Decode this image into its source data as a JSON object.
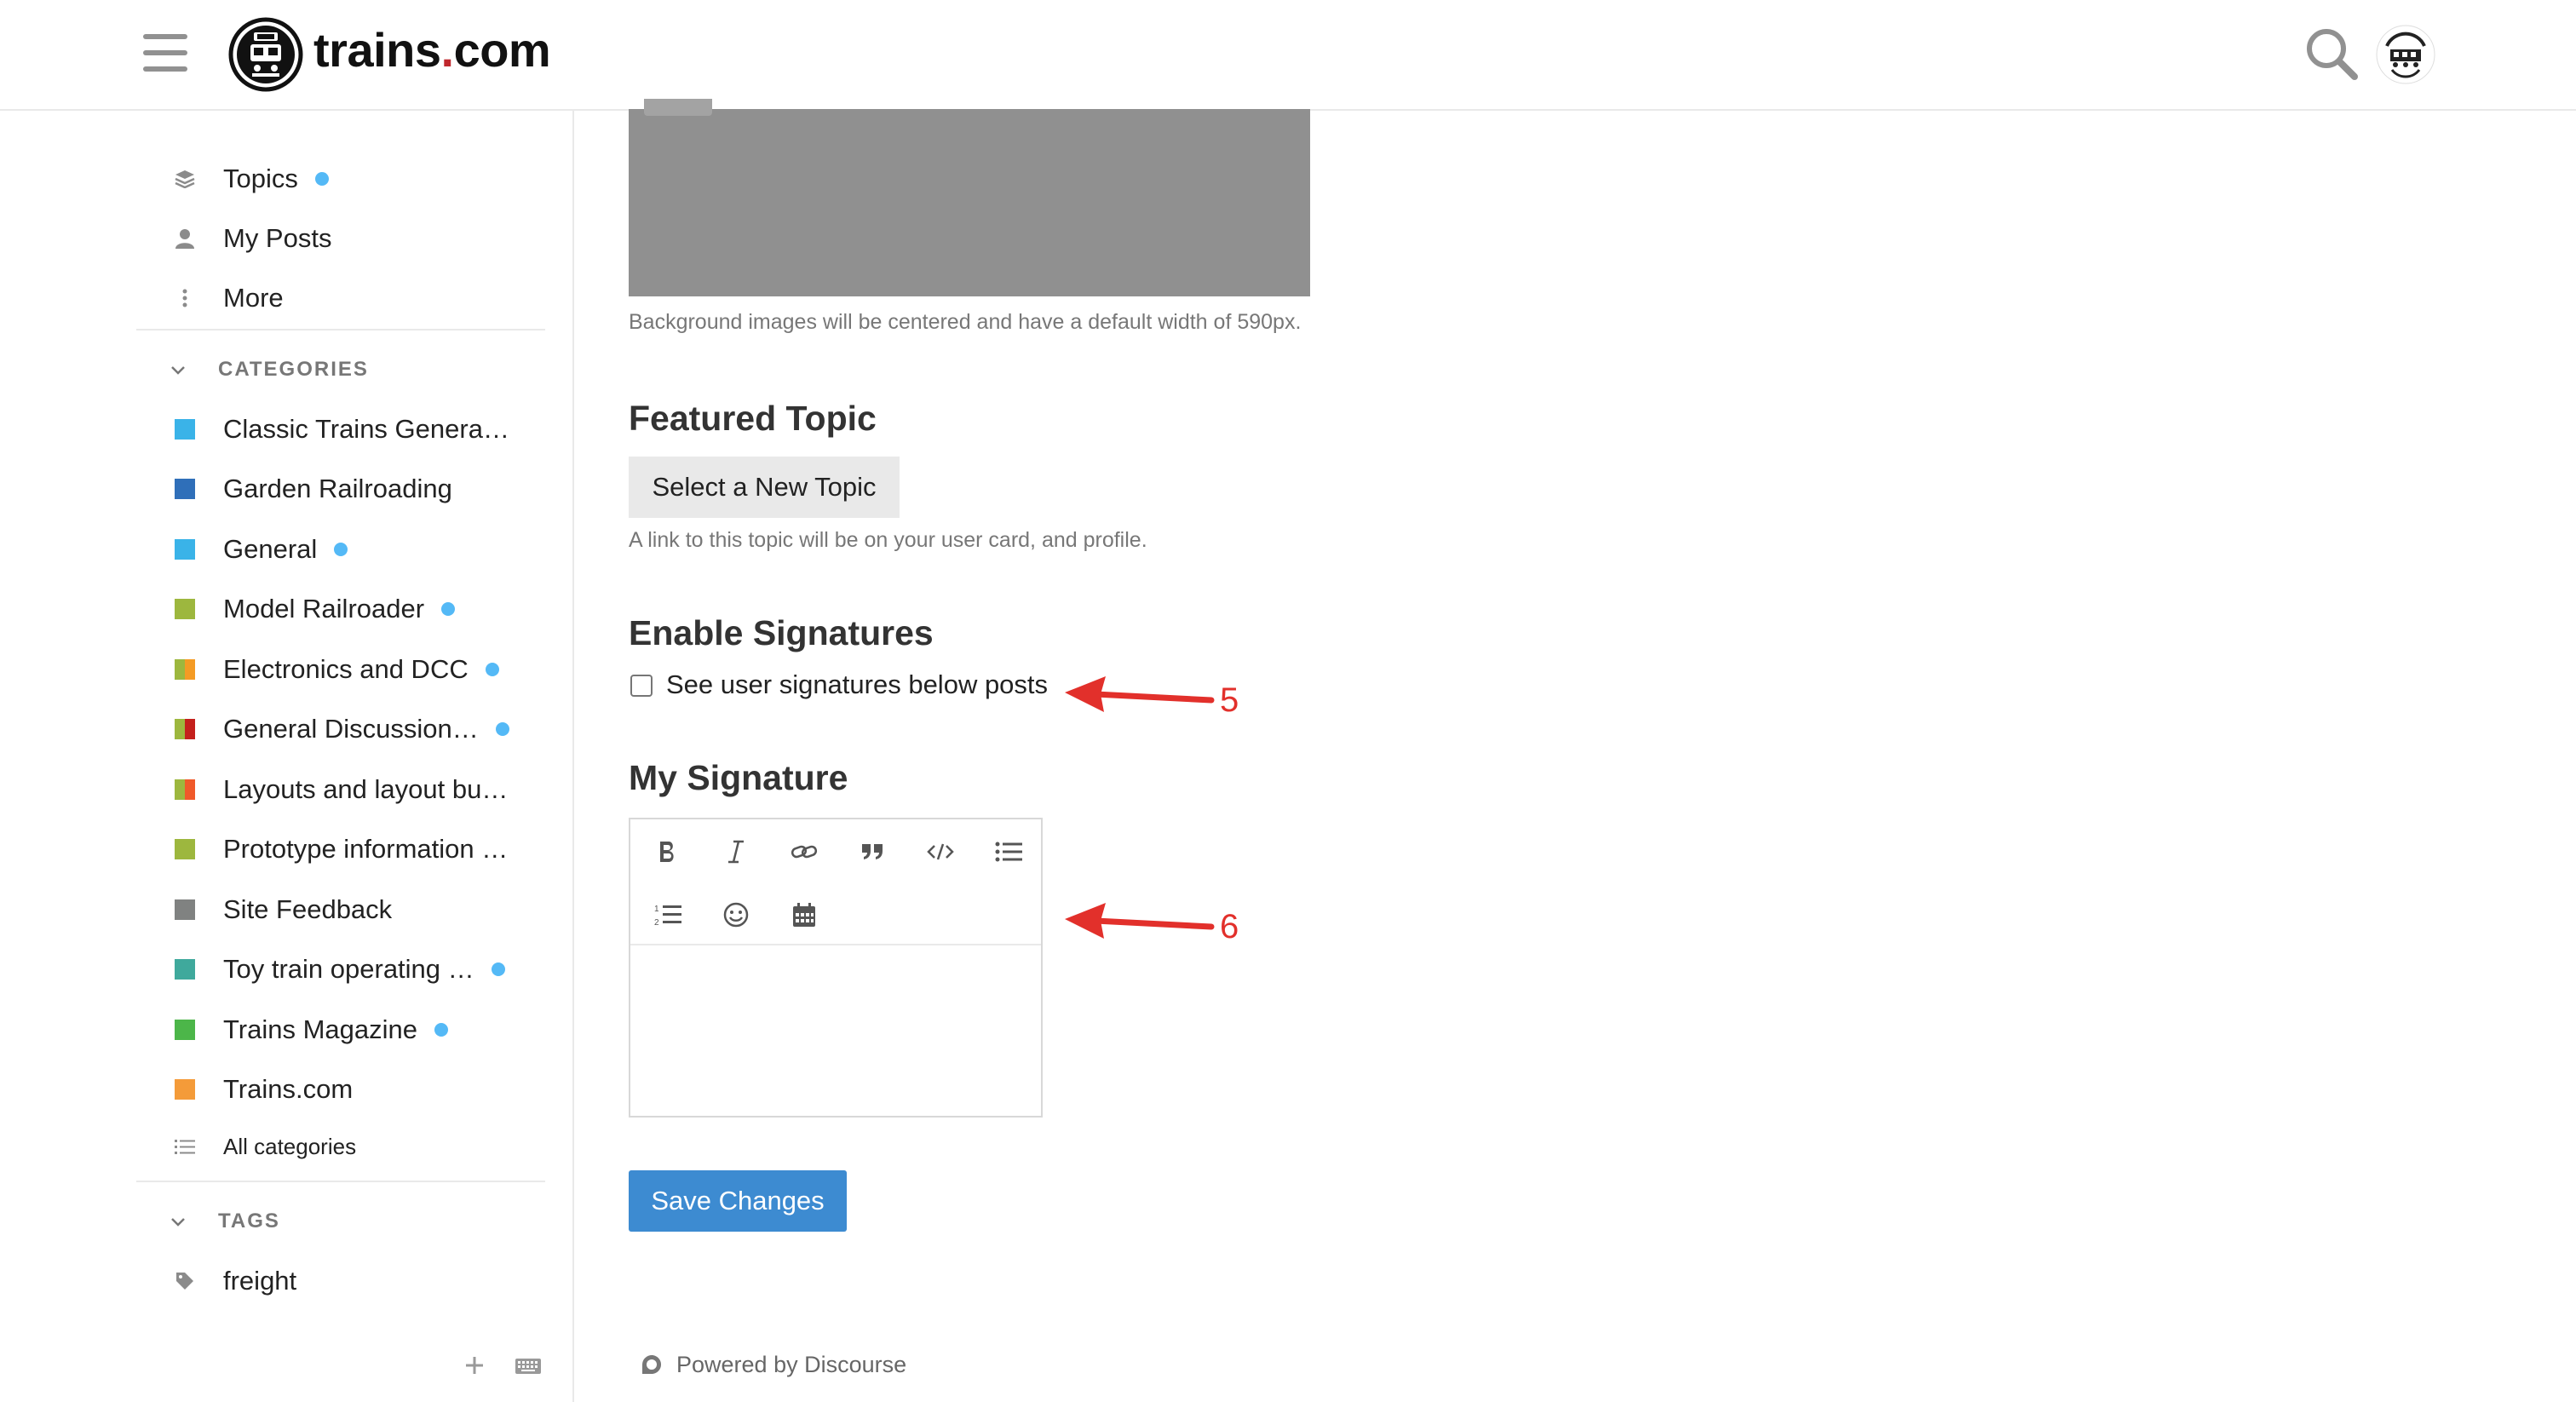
{
  "header": {
    "logo_prefix": "trains",
    "logo_dot": ".",
    "logo_suffix": "com",
    "avatar_text": "MOSS VALLEY RAILROAD CLUB"
  },
  "sidebar": {
    "nav": [
      {
        "label": "Topics",
        "icon": "layers-icon",
        "new": true
      },
      {
        "label": "My Posts",
        "icon": "user-icon",
        "new": false
      },
      {
        "label": "More",
        "icon": "ellipsis-vertical-icon",
        "new": false
      }
    ],
    "categories_heading": "CATEGORIES",
    "categories": [
      {
        "label": "Classic Trains Genera…",
        "color": "#3ab3e8",
        "color2": null,
        "new": false
      },
      {
        "label": "Garden Railroading",
        "color": "#2f6fb9",
        "color2": null,
        "new": false
      },
      {
        "label": "General",
        "color": "#3ab3e8",
        "color2": null,
        "new": true
      },
      {
        "label": "Model Railroader",
        "color": "#9db73e",
        "color2": null,
        "new": true
      },
      {
        "label": "Electronics and DCC",
        "color": "#9db73e",
        "color2": "#f49b24",
        "new": true
      },
      {
        "label": "General Discussion…",
        "color": "#9db73e",
        "color2": "#c4201c",
        "new": true
      },
      {
        "label": "Layouts and layout bu…",
        "color": "#9db73e",
        "color2": "#f0592a",
        "new": false
      },
      {
        "label": "Prototype information …",
        "color": "#9db73e",
        "color2": null,
        "new": false
      },
      {
        "label": "Site Feedback",
        "color": "#808281",
        "color2": null,
        "new": false
      },
      {
        "label": "Toy train operating …",
        "color": "#3fa99c",
        "color2": null,
        "new": true
      },
      {
        "label": "Trains Magazine",
        "color": "#4cb649",
        "color2": null,
        "new": true
      },
      {
        "label": "Trains.com",
        "color": "#f49b39",
        "color2": null,
        "new": false
      }
    ],
    "all_categories": "All categories",
    "tags_heading": "TAGS",
    "tags": [
      {
        "label": "freight"
      }
    ]
  },
  "main": {
    "background_help": "Background images will be centered and have a default width of 590px.",
    "featured_topic": {
      "title": "Featured Topic",
      "button": "Select a New Topic",
      "help": "A link to this topic will be on your user card, and profile."
    },
    "enable_signatures": {
      "title": "Enable Signatures",
      "checkbox_label": "See user signatures below posts",
      "checked": false
    },
    "my_signature": {
      "title": "My Signature",
      "toolbar": [
        "bold-icon",
        "italic-icon",
        "link-icon",
        "quote-icon",
        "code-icon",
        "bullet-list-icon",
        "numbered-list-icon",
        "emoji-icon",
        "calendar-icon"
      ],
      "value": ""
    },
    "save_button": "Save Changes",
    "footer": "Powered by Discourse"
  },
  "annotations": {
    "arrow_color": "#e2302b",
    "labels": [
      "5",
      "6"
    ]
  }
}
